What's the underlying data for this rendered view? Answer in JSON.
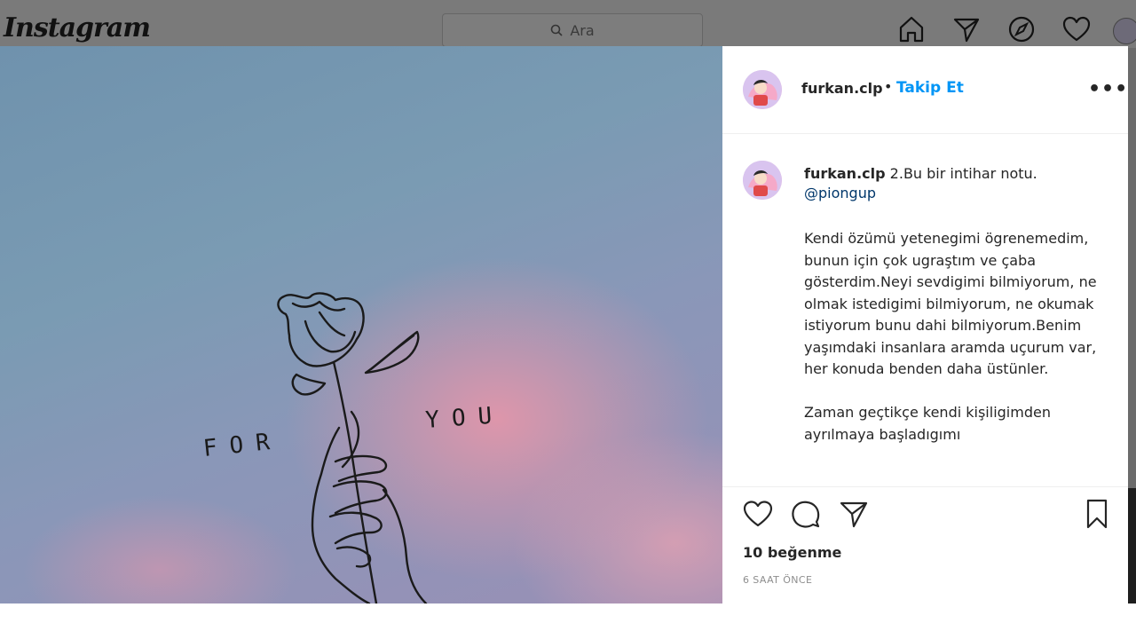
{
  "topnav": {
    "logo": "Instagram",
    "search_placeholder": "Ara",
    "icons": [
      "home-icon",
      "direct-icon",
      "explore-icon",
      "activity-icon"
    ]
  },
  "post": {
    "image_text": [
      "FOR",
      "YOU"
    ],
    "username": "furkan.clp",
    "separator": "•",
    "follow_label": "Takip Et",
    "more_label": "•••",
    "caption_first_line": "2.Bu bir intihar notu.",
    "mention": "@piongup",
    "body": "Kendi özümü yetenegimi ögrenemedim, bunun için çok ugraştım ve çaba gösterdim.Neyi sevdigimi bilmiyorum, ne olmak istedigimi bilmiyorum, ne okumak istiyorum bunu dahi bilmiyorum.Benim yaşımdaki insanlara aramda uçurum var, her konuda benden daha üstünler.\n\nZaman geçtikçe kendi kişiligimden ayrılmaya başladıgımı",
    "likes": "10 beğenme",
    "time": "6 SAAT ÖNCE"
  },
  "colors": {
    "accent": "#0095f6",
    "mention": "#00376b",
    "text": "#262626",
    "muted": "#8e8e8e"
  }
}
